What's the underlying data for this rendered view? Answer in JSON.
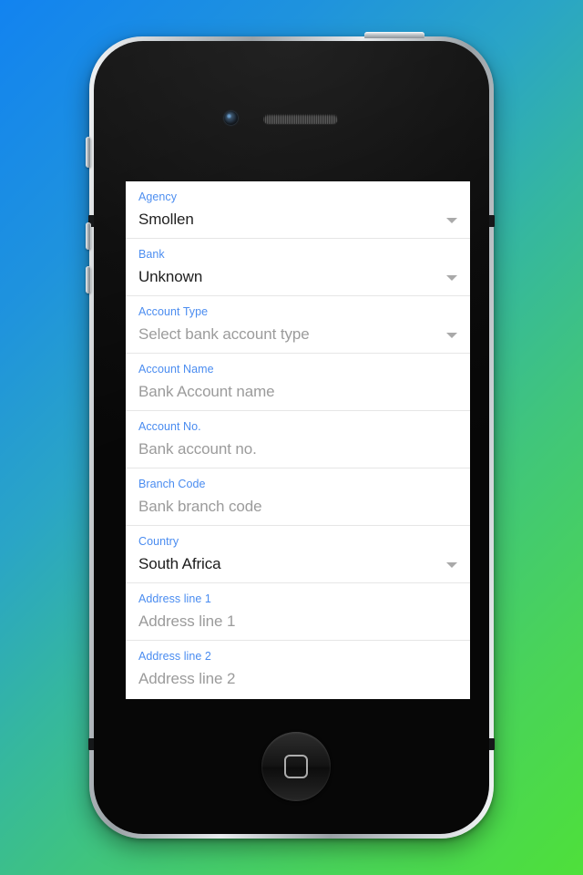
{
  "device": {
    "type": "smartphone-mockup",
    "hardware": {
      "camera": "front-camera",
      "speaker": "earpiece-speaker",
      "home_button": "home-button",
      "power_button": "power-button",
      "silence_switch": "silence-switch",
      "volume_up": "volume-up-button",
      "volume_down": "volume-down-button"
    }
  },
  "background": {
    "gradient_from": "#1283f0",
    "gradient_mid": "#2aa5c6",
    "gradient_to": "#4ee03a"
  },
  "theme": {
    "label_color": "#4a8cf0",
    "value_color": "#1b1b1b",
    "placeholder_color": "#9b9b9b",
    "divider_color": "#e6e6e6",
    "caret_color": "#a9a9a9",
    "card_background": "#ffffff"
  },
  "form": {
    "rows": [
      {
        "label": "Agency",
        "value": "Smollen",
        "is_placeholder": false,
        "has_dropdown": true
      },
      {
        "label": "Bank",
        "value": "Unknown",
        "is_placeholder": false,
        "has_dropdown": true
      },
      {
        "label": "Account Type",
        "value": "Select bank account type",
        "is_placeholder": true,
        "has_dropdown": true
      },
      {
        "label": "Account Name",
        "value": "Bank Account name",
        "is_placeholder": true,
        "has_dropdown": false
      },
      {
        "label": "Account No.",
        "value": "Bank account no.",
        "is_placeholder": true,
        "has_dropdown": false
      },
      {
        "label": "Branch Code",
        "value": "Bank branch code",
        "is_placeholder": true,
        "has_dropdown": false
      },
      {
        "label": "Country",
        "value": "South Africa",
        "is_placeholder": false,
        "has_dropdown": true
      },
      {
        "label": "Address line 1",
        "value": "Address line 1",
        "is_placeholder": true,
        "has_dropdown": false
      },
      {
        "label": "Address line 2",
        "value": "Address line 2",
        "is_placeholder": true,
        "has_dropdown": false
      }
    ]
  }
}
